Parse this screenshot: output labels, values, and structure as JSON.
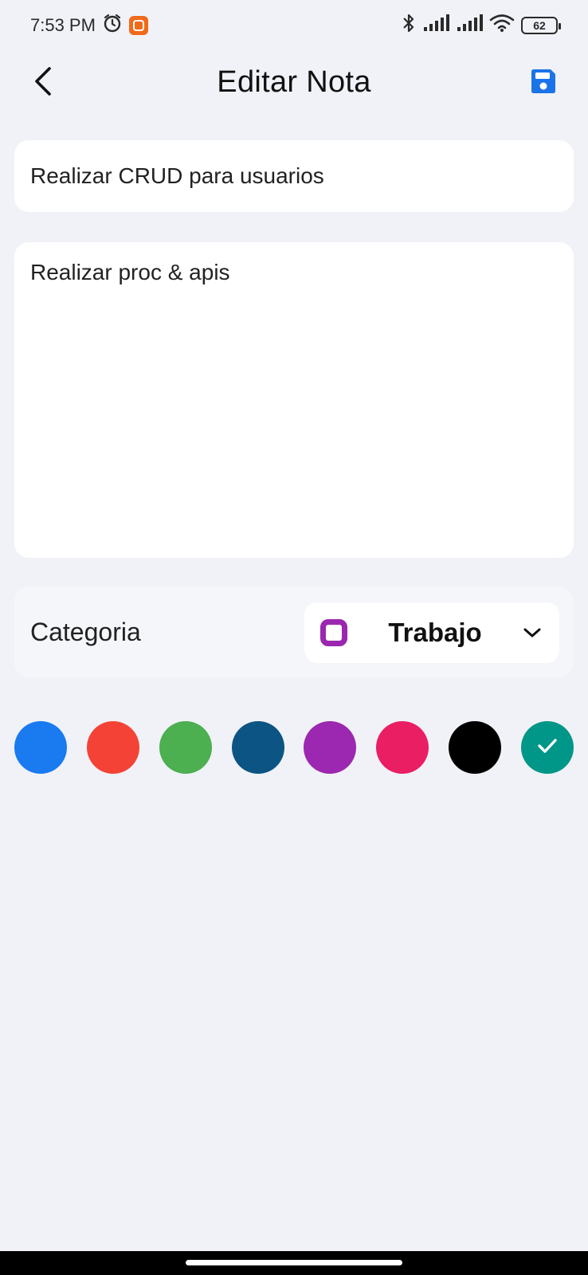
{
  "status_bar": {
    "time": "7:53 PM",
    "battery_level": "62"
  },
  "header": {
    "title": "Editar Nota"
  },
  "note": {
    "title_value": "Realizar CRUD para usuarios",
    "body_value": "Realizar proc & apis"
  },
  "category": {
    "label": "Categoria",
    "selected": "Trabajo",
    "selected_color": "#9b27b0"
  },
  "colors": {
    "options": [
      "#1a7af0",
      "#f44336",
      "#4caf50",
      "#0c5483",
      "#9c27b0",
      "#e91e63",
      "#000000",
      "#009688"
    ],
    "selected_index": 7
  },
  "icons": {
    "back": "back-arrow-icon",
    "save": "save-icon",
    "dropdown": "chevron-down-icon",
    "check": "check-icon"
  }
}
